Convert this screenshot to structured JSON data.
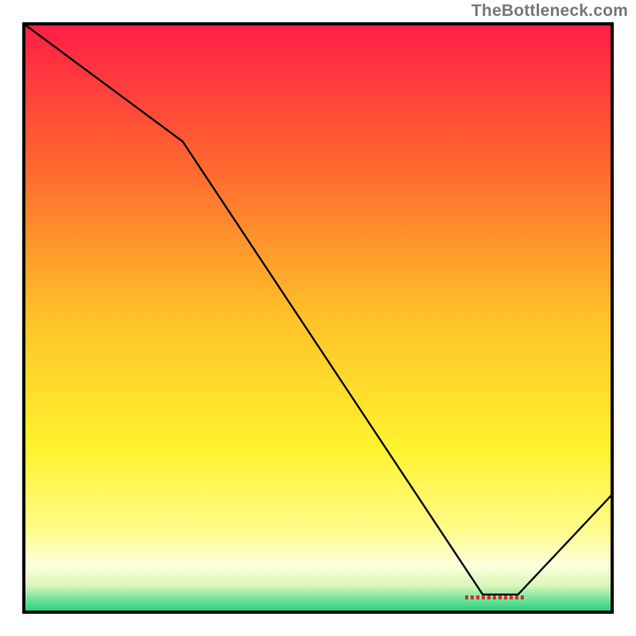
{
  "watermark": "TheBottleneck.com",
  "marker_label": "",
  "chart_data": {
    "type": "line",
    "title": "",
    "xlabel": "",
    "ylabel": "",
    "xlim": [
      0,
      100
    ],
    "ylim": [
      0,
      100
    ],
    "grid": false,
    "series": [
      {
        "name": "curve",
        "x": [
          0,
          27,
          78,
          84,
          100
        ],
        "values": [
          100,
          80,
          3,
          3,
          20
        ]
      }
    ],
    "gradient_stops": [
      {
        "offset": 0.0,
        "color": "#ff1e46"
      },
      {
        "offset": 0.25,
        "color": "#ff6a2f"
      },
      {
        "offset": 0.5,
        "color": "#ffc229"
      },
      {
        "offset": 0.72,
        "color": "#fff22e"
      },
      {
        "offset": 0.86,
        "color": "#fffc8a"
      },
      {
        "offset": 0.92,
        "color": "#ffffdd"
      },
      {
        "offset": 0.955,
        "color": "#d8f7b8"
      },
      {
        "offset": 0.975,
        "color": "#7fe6a0"
      },
      {
        "offset": 1.0,
        "color": "#1fd07a"
      }
    ],
    "minimum_marker": {
      "x_start": 75,
      "x_end": 85,
      "y": 2.5,
      "color": "#d62f2f"
    }
  },
  "colors": {
    "axis": "#000000",
    "curve": "#000000",
    "watermark": "#787878"
  }
}
